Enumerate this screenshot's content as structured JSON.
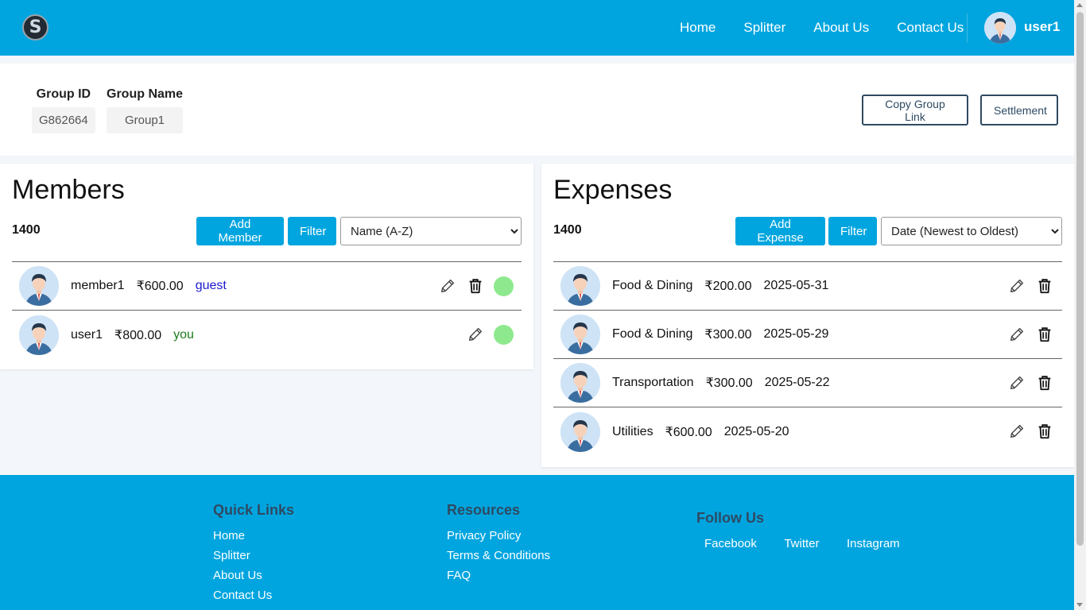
{
  "nav": {
    "logo_letter": "S",
    "links": [
      "Home",
      "Splitter",
      "About Us",
      "Contact Us"
    ],
    "username": "user1"
  },
  "group": {
    "id_label": "Group ID",
    "id_value": "G862664",
    "name_label": "Group Name",
    "name_value": "Group1",
    "copy_link_label": "Copy Group Link",
    "settlement_label": "Settlement"
  },
  "members": {
    "title": "Members",
    "total": "1400",
    "add_label": "Add Member",
    "filter_label": "Filter",
    "sort_selected": "Name (A-Z)",
    "rows": [
      {
        "name": "member1",
        "amount": "₹600.00",
        "tag": "guest"
      },
      {
        "name": "user1",
        "amount": "₹800.00",
        "tag": "you"
      }
    ]
  },
  "expenses": {
    "title": "Expenses",
    "total": "1400",
    "add_label": "Add Expense",
    "filter_label": "Filter",
    "sort_selected": "Date (Newest to Oldest)",
    "rows": [
      {
        "category": "Food & Dining",
        "amount": "₹200.00",
        "date": "2025-05-31"
      },
      {
        "category": "Food & Dining",
        "amount": "₹300.00",
        "date": "2025-05-29"
      },
      {
        "category": "Transportation",
        "amount": "₹300.00",
        "date": "2025-05-22"
      },
      {
        "category": "Utilities",
        "amount": "₹600.00",
        "date": "2025-05-20"
      }
    ]
  },
  "footer": {
    "quick_links_title": "Quick Links",
    "quick_links": [
      "Home",
      "Splitter",
      "About Us",
      "Contact Us"
    ],
    "resources_title": "Resources",
    "resources": [
      "Privacy Policy",
      "Terms & Conditions",
      "FAQ"
    ],
    "follow_title": "Follow Us",
    "social": [
      "Facebook",
      "Twitter",
      "Instagram"
    ]
  },
  "colors": {
    "primary": "#00a5df",
    "dark_text": "#2e4a62",
    "status_green": "#8ee98e",
    "guest_tag": "#1a1ad0",
    "you_tag": "#1a7a1a"
  }
}
